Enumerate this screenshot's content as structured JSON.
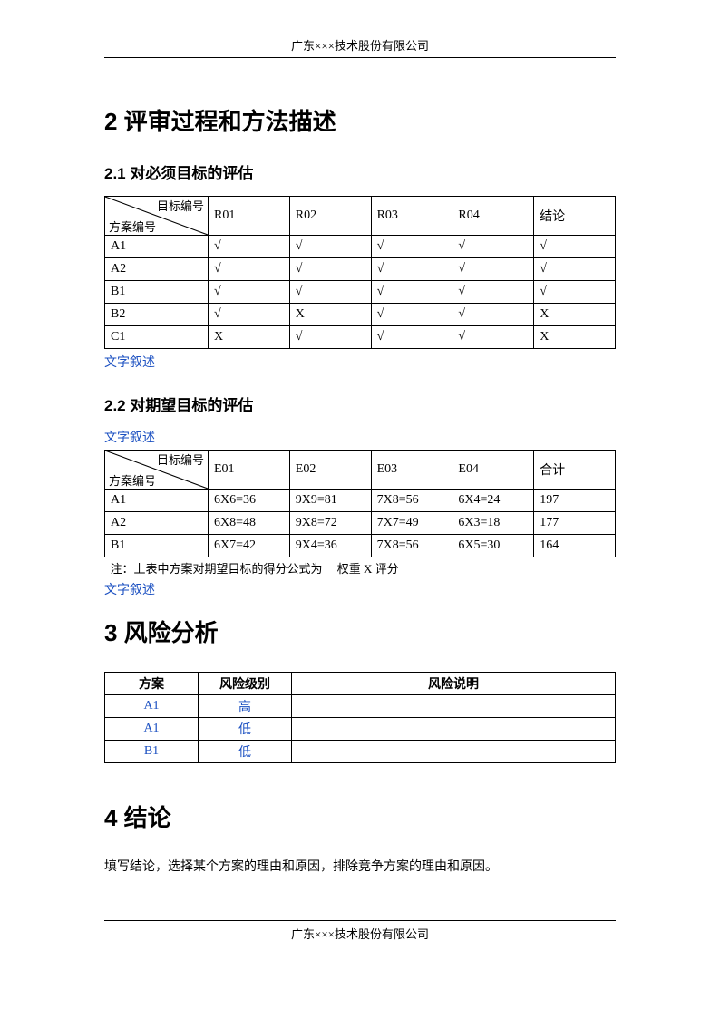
{
  "header": "广东×××技术股份有限公司",
  "footer": "广东×××技术股份有限公司",
  "sec2": {
    "title": "2 评审过程和方法描述",
    "s21": {
      "title": "2.1 对必须目标的评估",
      "diag_top": "目标编号",
      "diag_bottom": "方案编号",
      "headers": [
        "R01",
        "R02",
        "R03",
        "R04",
        "结论"
      ],
      "rows": [
        {
          "name": "A1",
          "cells": [
            "√",
            "√",
            "√",
            "√",
            "√"
          ]
        },
        {
          "name": "A2",
          "cells": [
            "√",
            "√",
            "√",
            "√",
            "√"
          ]
        },
        {
          "name": "B1",
          "cells": [
            "√",
            "√",
            "√",
            "√",
            "√"
          ]
        },
        {
          "name": "B2",
          "cells": [
            "√",
            "X",
            "√",
            "√",
            "X"
          ]
        },
        {
          "name": "C1",
          "cells": [
            "X",
            "√",
            "√",
            "√",
            "X"
          ]
        }
      ],
      "note": "文字叙述"
    },
    "s22": {
      "title": "2.2 对期望目标的评估",
      "note_top": "文字叙述",
      "diag_top": "目标编号",
      "diag_bottom": "方案编号",
      "headers": [
        "E01",
        "E02",
        "E03",
        "E04",
        "合计"
      ],
      "rows": [
        {
          "name": "A1",
          "cells": [
            "6X6=36",
            "9X9=81",
            "7X8=56",
            "6X4=24",
            "197"
          ]
        },
        {
          "name": "A2",
          "cells": [
            "6X8=48",
            "9X8=72",
            "7X7=49",
            "6X3=18",
            "177"
          ]
        },
        {
          "name": "B1",
          "cells": [
            "6X7=42",
            "9X4=36",
            "7X8=56",
            "6X5=30",
            "164"
          ]
        }
      ],
      "note_mid": "  注：上表中方案对期望目标的得分公式为     权重 X 评分",
      "note_bottom": "文字叙述"
    }
  },
  "sec3": {
    "title": "3 风险分析",
    "headers": [
      "方案",
      "风险级别",
      "风险说明"
    ],
    "rows": [
      {
        "plan": "A1",
        "level": "高",
        "desc": ""
      },
      {
        "plan": "A1",
        "level": "低",
        "desc": ""
      },
      {
        "plan": "B1",
        "level": "低",
        "desc": ""
      }
    ]
  },
  "sec4": {
    "title": "4 结论",
    "body": "填写结论，选择某个方案的理由和原因，排除竞争方案的理由和原因。"
  }
}
